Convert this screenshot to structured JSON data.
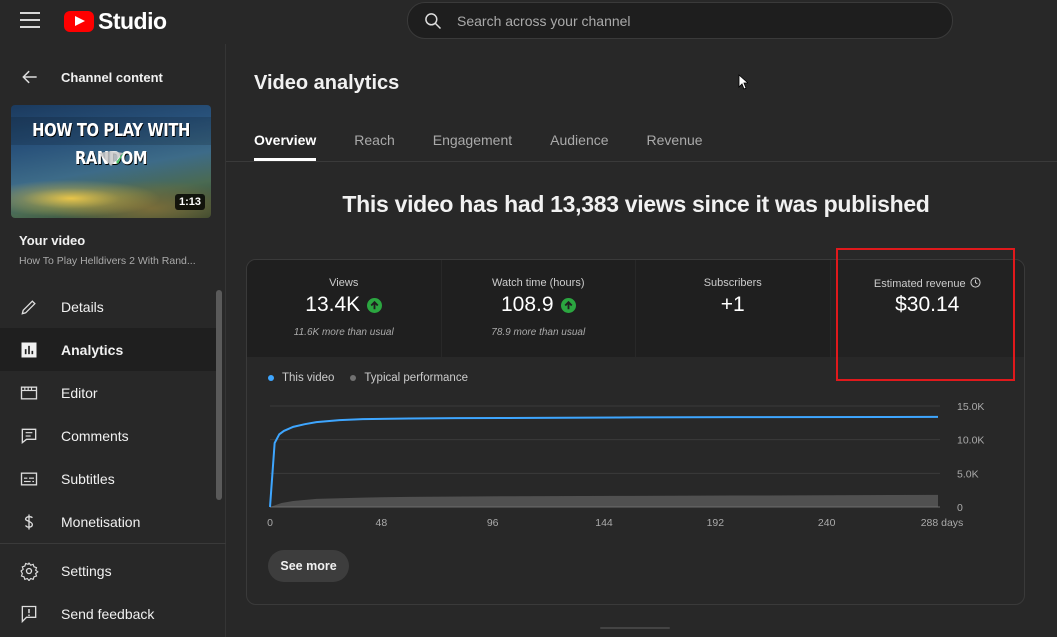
{
  "header": {
    "logo_text": "Studio",
    "search_placeholder": "Search across your channel"
  },
  "sidebar": {
    "back_label": "Channel content",
    "thumbnail": {
      "title_text": "HOW TO PLAY WITH RANDOM",
      "duration": "1:13"
    },
    "your_video_label": "Your video",
    "video_title": "How To Play Helldivers 2 With Rand...",
    "nav_items": [
      {
        "label": "Details",
        "icon": "pencil-icon"
      },
      {
        "label": "Analytics",
        "icon": "bar-chart-icon",
        "active": true
      },
      {
        "label": "Editor",
        "icon": "film-editor-icon"
      },
      {
        "label": "Comments",
        "icon": "comment-icon"
      },
      {
        "label": "Subtitles",
        "icon": "subtitles-icon"
      },
      {
        "label": "Monetisation",
        "icon": "dollar-icon"
      }
    ],
    "bottom_items": [
      {
        "label": "Settings",
        "icon": "gear-icon"
      },
      {
        "label": "Send feedback",
        "icon": "feedback-icon"
      }
    ]
  },
  "main": {
    "title": "Video analytics",
    "tabs": [
      "Overview",
      "Reach",
      "Engagement",
      "Audience",
      "Revenue"
    ],
    "active_tab": "Overview",
    "headline": "This video has had 13,383 views since it was published",
    "metrics": [
      {
        "label": "Views",
        "value": "13.4K",
        "trend": "up",
        "note": "11.6K more than usual"
      },
      {
        "label": "Watch time (hours)",
        "value": "108.9",
        "trend": "up",
        "note": "78.9 more than usual"
      },
      {
        "label": "Subscribers",
        "value": "+1",
        "trend": "",
        "note": ""
      },
      {
        "label": "Estimated revenue",
        "value": "$30.14",
        "trend": "",
        "note": ""
      }
    ],
    "see_more_label": "See more"
  },
  "colors": {
    "this_video": "#3ea6ff",
    "typical": "#717171",
    "trend_up": "#2ba640",
    "highlight_box": "#e0191c"
  },
  "chart_data": {
    "type": "line",
    "legend": [
      "This video",
      "Typical performance"
    ],
    "x_ticks": [
      "0",
      "48",
      "96",
      "144",
      "192",
      "240",
      "288 days"
    ],
    "y_ticks": [
      "15.0K",
      "10.0K",
      "5.0K",
      "0"
    ],
    "xlim": [
      0,
      288
    ],
    "ylim": [
      0,
      15000
    ],
    "series": [
      {
        "name": "This video",
        "x": [
          0,
          2,
          4,
          6,
          10,
          15,
          20,
          30,
          40,
          60,
          80,
          100,
          150,
          200,
          288
        ],
        "values": [
          0,
          9500,
          10800,
          11300,
          11900,
          12300,
          12600,
          12900,
          13050,
          13150,
          13200,
          13220,
          13300,
          13350,
          13383
        ]
      },
      {
        "name": "Typical performance",
        "x": [
          0,
          5,
          10,
          20,
          40,
          60,
          100,
          150,
          200,
          288
        ],
        "values": [
          0,
          600,
          900,
          1200,
          1400,
          1500,
          1600,
          1650,
          1700,
          1800
        ]
      }
    ]
  }
}
